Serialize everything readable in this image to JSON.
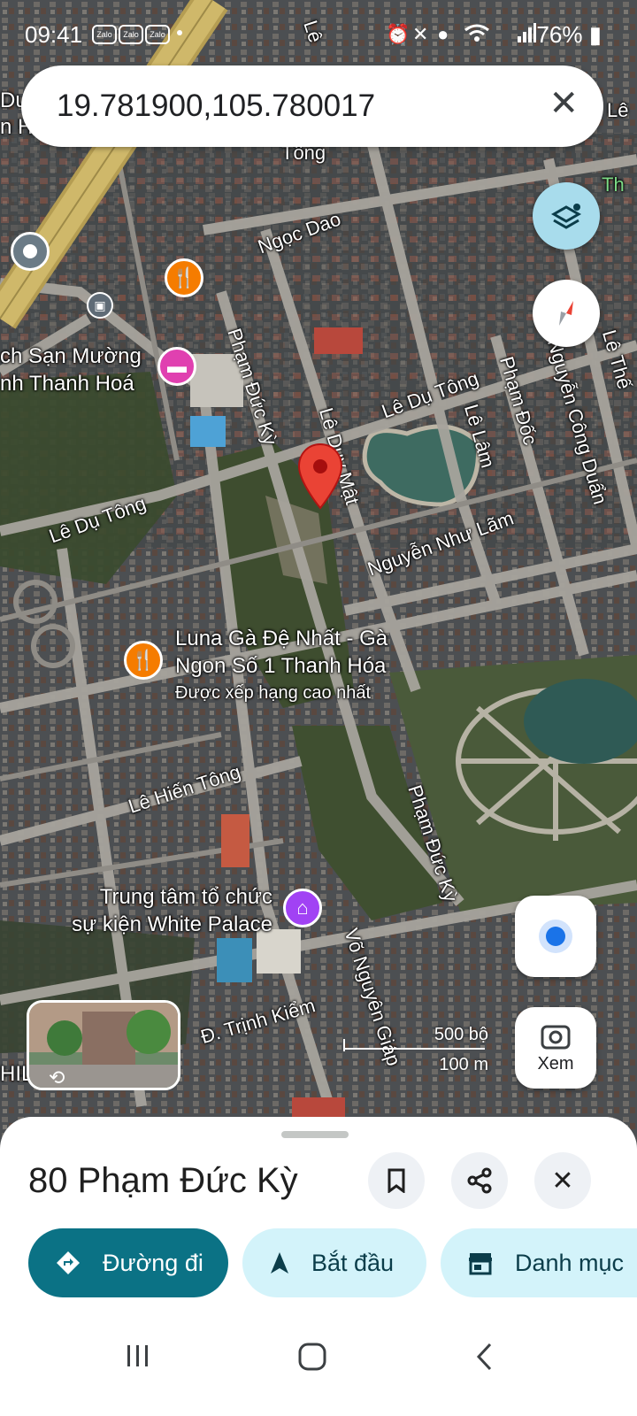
{
  "status_bar": {
    "time": "09:41",
    "notif_apps": [
      "Zalo",
      "Zalo",
      "Zalo"
    ],
    "battery": "76%"
  },
  "search": {
    "query": "19.781900,105.780017",
    "clear_icon": "close-icon"
  },
  "map": {
    "streets": [
      "Tông",
      "Ngọc Dao",
      "Phạm Đức Kỳ",
      "Lê Dụ Tông",
      "Lê Duy Mật",
      "Lê Lâm",
      "Phạm Đốc",
      "Nguyễn Công Duẩn",
      "Lê Thế",
      "Lê Dụ Tông",
      "Nguyễn Như Lãm",
      "Lê Hiến Tông",
      "Phạm Đức Kỳ",
      "Võ Nguyên Giáp",
      "Đ. Trịnh Kiểm",
      "Lê",
      "Lê",
      "Th"
    ],
    "poi_hotel": [
      "ch Sạn Mường",
      "nh Thanh Hoá"
    ],
    "poi_restaurant": [
      "Luna Gà Đệ Nhất - Gà",
      "Ngon Số 1 Thanh Hóa"
    ],
    "poi_restaurant_sub": "Được xếp hạng cao nhất",
    "poi_event": [
      "Trung tâm tổ chức",
      "sự kiện White Palace"
    ],
    "edge_text": [
      "Dư",
      "n H",
      "HIL"
    ],
    "scale_feet": "500 bộ",
    "scale_meters": "100 m",
    "street_view_icon": "street-view-thumbnail"
  },
  "buttons": {
    "layers_icon": "layers-icon",
    "compass_icon": "compass-icon",
    "location_icon": "my-location-icon",
    "lens_label": "Xem"
  },
  "sheet": {
    "title": "80 Phạm Đức Kỳ",
    "chips": {
      "directions": "Đường đi",
      "start": "Bắt đầu",
      "category": "Danh mục"
    }
  },
  "colors": {
    "primary_chip": "#0b7285",
    "secondary_chip": "#d3f3fa",
    "pin_red": "#ea4335",
    "restaurant": "#f57c00",
    "hotel": "#e040b0",
    "event": "#a142f4"
  }
}
